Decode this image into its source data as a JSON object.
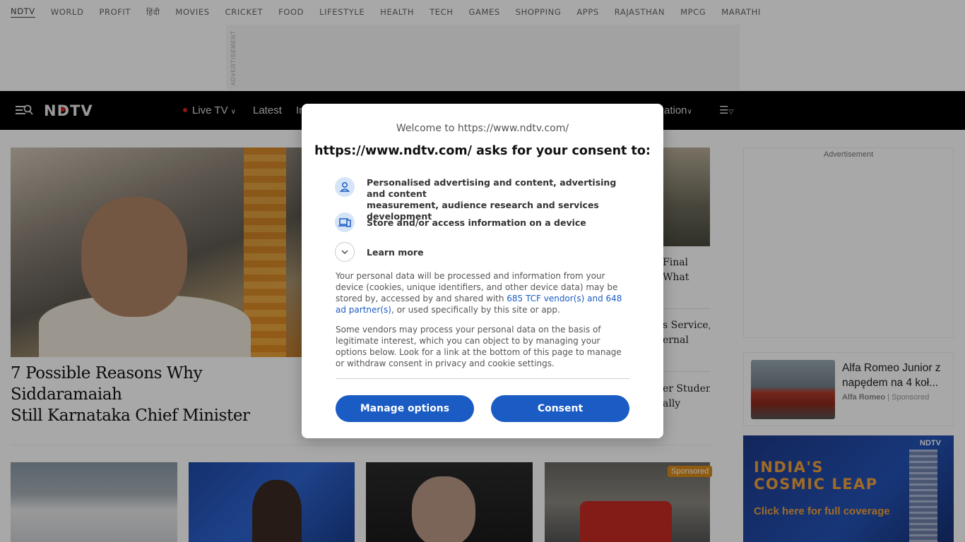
{
  "top_nav": [
    "NDTV",
    "WORLD",
    "PROFIT",
    "हिंदी",
    "MOVIES",
    "CRICKET",
    "FOOD",
    "LIFESTYLE",
    "HEALTH",
    "TECH",
    "GAMES",
    "SHOPPING",
    "APPS",
    "RAJASTHAN",
    "MPCG",
    "MARATHI"
  ],
  "ad_label_vertical": "ADVERTISEMENT",
  "navbar": {
    "logo": "NDTV",
    "live_tv": "Live TV",
    "latest": "Latest",
    "partial_left": "In",
    "partial_right": "ation"
  },
  "hero": {
    "headline_line1": "7 Possible Reasons Why Siddaramaiah",
    "headline_line2": "Still Karnataka Chief Minister"
  },
  "right_stories": [
    [
      "Final",
      "What"
    ],
    [
      "s Service,",
      "ernal"
    ],
    [
      "er Student",
      "ally"
    ]
  ],
  "sponsored_badge": "Sponsored",
  "sidebar": {
    "ad_label": "Advertisement",
    "sponsor_title": "Alfa Romeo Junior z napędem na 4 koł...",
    "sponsor_brand": "Alfa Romeo",
    "sponsor_tag": "Sponsored",
    "cosmic_logo": "NDTV",
    "cosmic_line1": "INDIA'S",
    "cosmic_line2": "COSMIC LEAP",
    "cosmic_cta": "Click here for full coverage"
  },
  "dialog": {
    "welcome": "Welcome to https://www.ndtv.com/",
    "title": "https://www.ndtv.com/ asks for your consent to:",
    "purpose1_line1": "Personalised advertising and content, advertising and content",
    "purpose1_line2": "measurement, audience research and services development",
    "purpose2": "Store and/or access information on a device",
    "learn_more": "Learn more",
    "para1_pre": "Your personal data will be processed and information from your device (cookies, unique identifiers, and other device data) may be stored by, accessed by and shared with ",
    "para1_link": "685 TCF vendor(s) and 648 ad partner(s)",
    "para1_post": ", or used specifically by this site or app.",
    "para2": "Some vendors may process your personal data on the basis of legitimate interest, which you can object to by managing your options below. Look for a link at the bottom of this page to manage or withdraw consent in privacy and cookie settings.",
    "manage_options": "Manage options",
    "consent": "Consent"
  }
}
